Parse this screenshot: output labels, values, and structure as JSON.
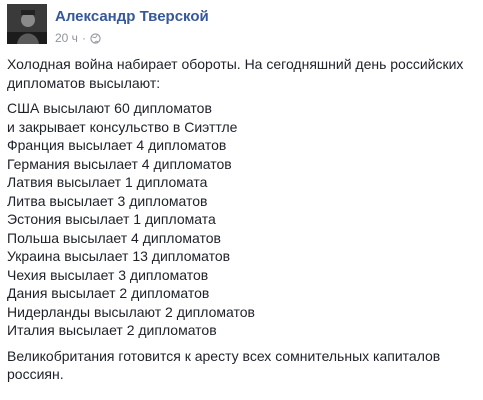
{
  "post": {
    "author": "Александр Тверской",
    "time": "20 ч",
    "separator": "·",
    "privacy_icon": "globe-icon",
    "intro_lines": [
      "Холодная война набирает обороты. На сегодняшний день российских",
      "дипломатов высылают:"
    ],
    "list_lines": [
      "США высылают 60 дипломатов",
      "и закрывает консульство в Сиэттле",
      "Франция высылает 4 дипломатов",
      "Германия высылает 4 дипломатов",
      "Латвия высылает 1 дипломата",
      "Литва высылает 3 дипломатов",
      "Эстония высылает 1 дипломата",
      "Польша высылает 4 дипломатов",
      "Украина высылает 13 дипломатов",
      "Чехия высылает 3 дипломатов",
      "Дания высылает 2 дипломатов",
      "Нидерланды высылают 2 дипломатов",
      "Италия высылает 2 дипломатов"
    ],
    "outro_lines": [
      "Великобритания готовится к аресту всех сомнительных капиталов",
      "россиян."
    ]
  },
  "colors": {
    "author_link": "#365899",
    "meta_text": "#90949c",
    "body_text": "#1d2129"
  }
}
